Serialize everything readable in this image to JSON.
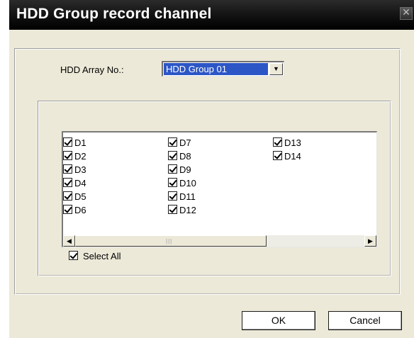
{
  "window": {
    "title": "HDD Group record channel",
    "close_symbol": "✕"
  },
  "array": {
    "label": "HDD Array No.:",
    "selected": "HDD Group 01",
    "arrow": "▼"
  },
  "channels": {
    "columns": [
      [
        {
          "label": "D1",
          "checked": true
        },
        {
          "label": "D2",
          "checked": true
        },
        {
          "label": "D3",
          "checked": true
        },
        {
          "label": "D4",
          "checked": true
        },
        {
          "label": "D5",
          "checked": true
        },
        {
          "label": "D6",
          "checked": true
        }
      ],
      [
        {
          "label": "D7",
          "checked": true
        },
        {
          "label": "D8",
          "checked": true
        },
        {
          "label": "D9",
          "checked": true
        },
        {
          "label": "D10",
          "checked": true
        },
        {
          "label": "D11",
          "checked": true
        },
        {
          "label": "D12",
          "checked": true
        }
      ],
      [
        {
          "label": "D13",
          "checked": true
        },
        {
          "label": "D14",
          "checked": true
        }
      ]
    ]
  },
  "scrollbar": {
    "left_arrow": "◀",
    "right_arrow": "▶",
    "grip": "|||"
  },
  "select_all": {
    "label": "Select All",
    "checked": true
  },
  "buttons": {
    "ok": "OK",
    "cancel": "Cancel"
  }
}
